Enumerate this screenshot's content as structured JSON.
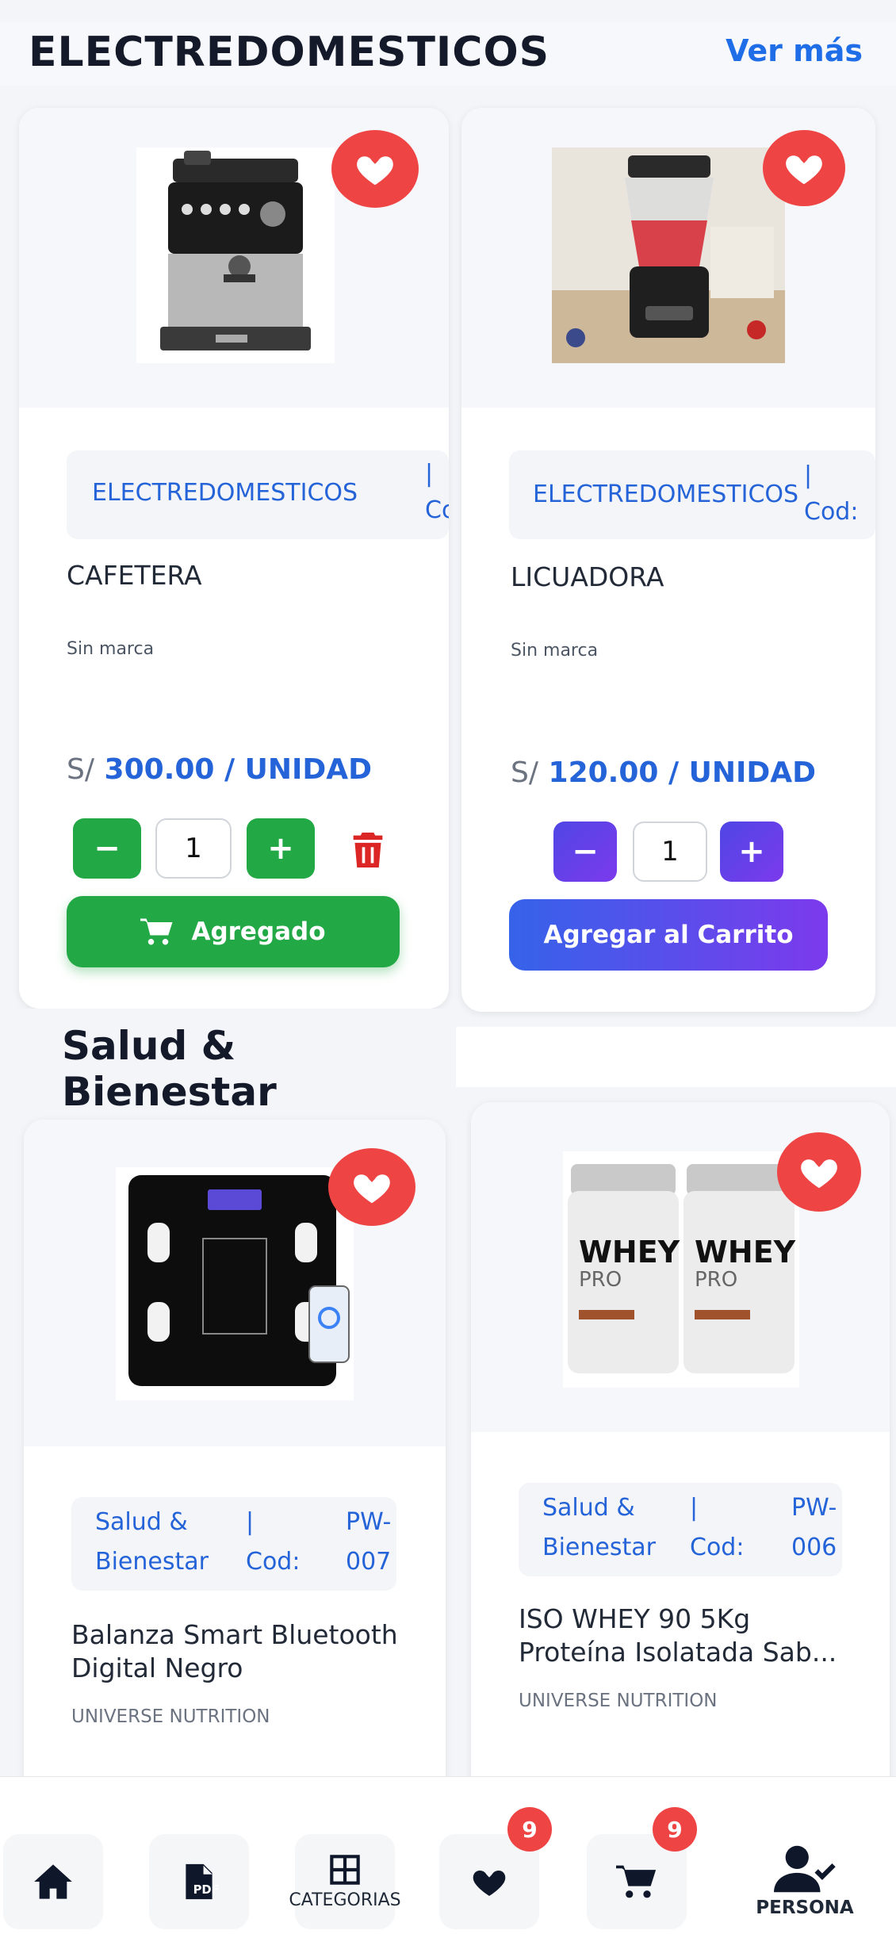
{
  "sections": [
    {
      "title": "ELECTREDOMESTICOS",
      "see_more": "Ver más",
      "products": [
        {
          "category_name": "ELECTREDOMESTICOS",
          "separator": "|",
          "cod_label": "Cod:",
          "name": "CAFETERA",
          "brand": "Sin marca",
          "currency": "S/",
          "price": "300.00 / UNIDAD",
          "qty": "1",
          "minus": "−",
          "plus": "+",
          "button_label": "Agregado"
        },
        {
          "category_name": "ELECTREDOMESTICOS",
          "separator": "|",
          "cod_label": "Cod:",
          "name": "LICUADORA",
          "brand": "Sin marca",
          "currency": "S/",
          "price": "120.00 / UNIDAD",
          "qty": "1",
          "minus": "−",
          "plus": "+",
          "button_label": "Agregar al Carrito"
        }
      ]
    },
    {
      "title": "Salud & Bienestar",
      "products": [
        {
          "category_line1": "Salud &",
          "category_line2": "Bienestar",
          "separator": "|",
          "cod_label": "Cod:",
          "code_line1": "PW-",
          "code_line2": "007",
          "name_line1": "Balanza Smart Bluetooth",
          "name_line2": "Digital Negro",
          "brand": "UNIVERSE NUTRITION"
        },
        {
          "category_line1": "Salud &",
          "category_line2": "Bienestar",
          "separator": "|",
          "cod_label": "Cod:",
          "code_line1": "PW-",
          "code_line2": "006",
          "name_line1": "ISO WHEY 90 5Kg",
          "name_line2": "Proteína Isolatada Sab...",
          "brand": "UNIVERSE NUTRITION",
          "image_text_1": "WHEY",
          "image_text_2": "PRO"
        }
      ]
    }
  ],
  "bottom_nav": {
    "categories_label": "CATEGORIAS",
    "favorites_count": "9",
    "cart_count": "9",
    "persona_label": "PERSONA",
    "pdf_label": "PDF"
  },
  "colors": {
    "accent_blue": "#2563d8",
    "added_green": "#22a845",
    "favorite_red": "#ef4444",
    "gradient_start": "#3563e9",
    "gradient_end": "#7c3aed"
  }
}
